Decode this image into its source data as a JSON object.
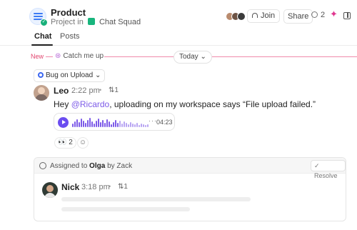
{
  "header": {
    "title": "Product",
    "subtitle_prefix": "Project in",
    "squad_name": "Chat Squad",
    "join_label": "Join",
    "share_label": "Share",
    "followers_count": "2"
  },
  "tabs": [
    {
      "label": "Chat",
      "active": true
    },
    {
      "label": "Posts",
      "active": false
    }
  ],
  "timeline": {
    "new_label": "New",
    "catch_up_label": "Catch me up",
    "date_label": "Today"
  },
  "tag": {
    "label": "Bug on Upload"
  },
  "message": {
    "author": "Leo",
    "time": "2:22 pm",
    "reply_count": "1",
    "text_before": "Hey ",
    "mention": "@Ricardo",
    "text_after": ", uploading on my workspace says “File upload failed.”",
    "voice_duration": "04:23",
    "reaction_emoji": "👀",
    "reaction_count": "2"
  },
  "assignment": {
    "prefix": "Assigned to",
    "assignee": "Olga",
    "by_text": "by Zack",
    "resolve_label": "Resolve",
    "reply_author": "Nick",
    "reply_time": "3:18 pm",
    "reply_count": "1"
  },
  "colors": {
    "accent": "#6b4df0",
    "mention": "#7d5be8",
    "new_divider": "#f08aaa",
    "squad": "#18b57d"
  },
  "icons": [
    "list-icon",
    "chat-squad-icon",
    "headphones-icon",
    "followers-icon",
    "sparkle-icon",
    "panel-icon",
    "catch-up-icon",
    "chevron-down-icon",
    "radio-icon",
    "reply-icon",
    "play-icon",
    "more-icon",
    "add-reaction-icon",
    "check-circle-icon",
    "check-icon"
  ]
}
